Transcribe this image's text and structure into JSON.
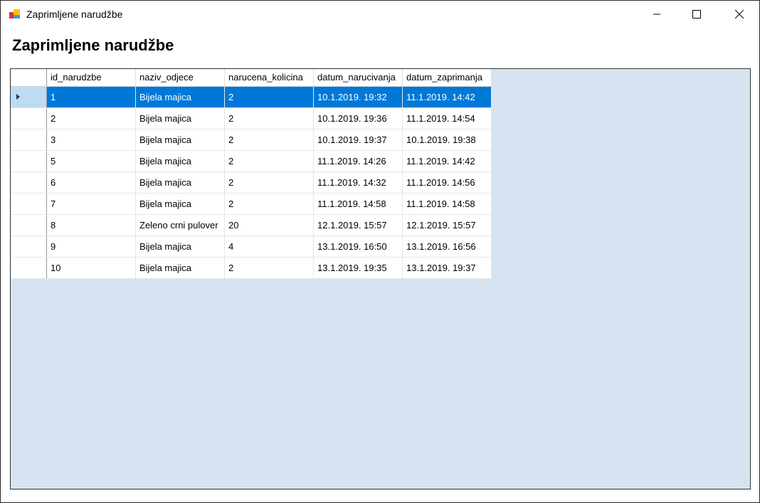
{
  "window": {
    "title": "Zaprimljene narudžbe"
  },
  "heading": "Zaprimljene narudžbe",
  "grid": {
    "columns": [
      "id_narudzbe",
      "naziv_odjece",
      "narucena_kolicina",
      "datum_narucivanja",
      "datum_zaprimanja"
    ],
    "selected_row": 0,
    "rows": [
      [
        "1",
        "Bijela majica",
        "2",
        "10.1.2019. 19:32",
        "11.1.2019. 14:42"
      ],
      [
        "2",
        "Bijela majica",
        "2",
        "10.1.2019. 19:36",
        "11.1.2019. 14:54"
      ],
      [
        "3",
        "Bijela majica",
        "2",
        "10.1.2019. 19:37",
        "10.1.2019. 19:38"
      ],
      [
        "5",
        "Bijela majica",
        "2",
        "11.1.2019. 14:26",
        "11.1.2019. 14:42"
      ],
      [
        "6",
        "Bijela majica",
        "2",
        "11.1.2019. 14:32",
        "11.1.2019. 14:56"
      ],
      [
        "7",
        "Bijela majica",
        "2",
        "11.1.2019. 14:58",
        "11.1.2019. 14:58"
      ],
      [
        "8",
        "Zeleno crni pulover",
        "20",
        "12.1.2019. 15:57",
        "12.1.2019. 15:57"
      ],
      [
        "9",
        "Bijela majica",
        "4",
        "13.1.2019. 16:50",
        "13.1.2019. 16:56"
      ],
      [
        "10",
        "Bijela majica",
        "2",
        "13.1.2019. 19:35",
        "13.1.2019. 19:37"
      ]
    ]
  },
  "colors": {
    "selection": "#0078d7",
    "grid_background": "#d6e4f1"
  }
}
